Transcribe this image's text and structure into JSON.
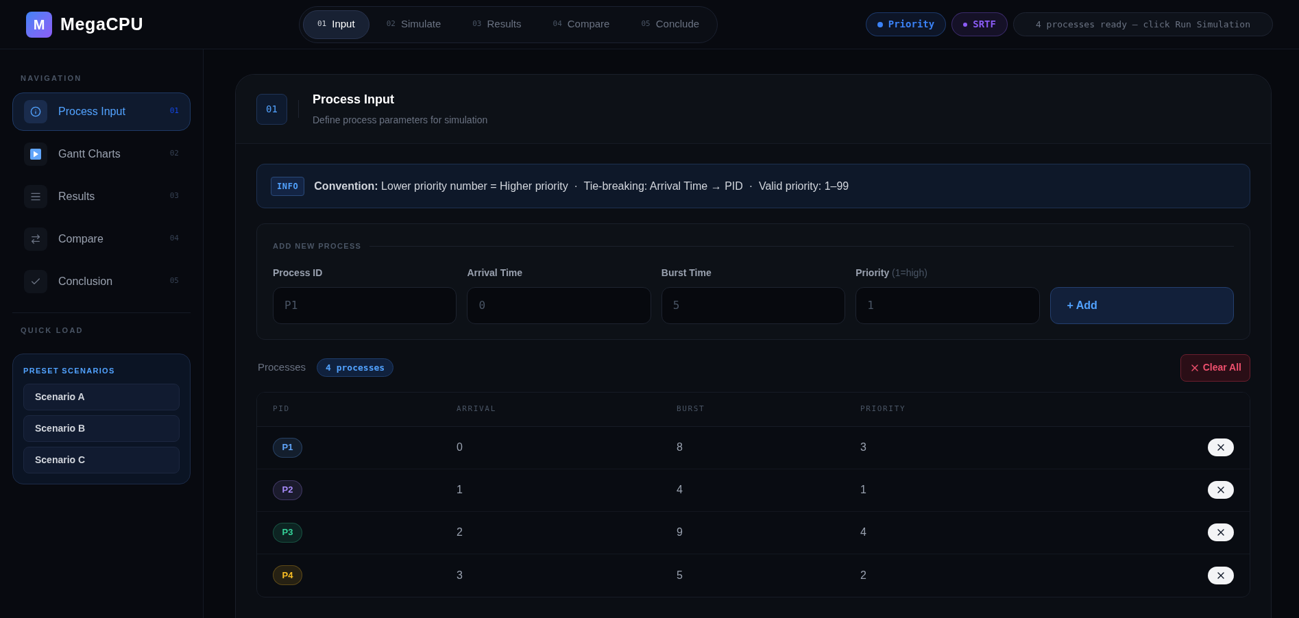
{
  "app": {
    "logo_letter": "M",
    "name": "MegaCPU"
  },
  "steps": [
    {
      "num": "01",
      "label": "Input",
      "selected": true
    },
    {
      "num": "02",
      "label": "Simulate",
      "selected": false
    },
    {
      "num": "03",
      "label": "Results",
      "selected": false
    },
    {
      "num": "04",
      "label": "Compare",
      "selected": false
    },
    {
      "num": "05",
      "label": "Conclude",
      "selected": false
    }
  ],
  "badges": [
    {
      "label": "Priority",
      "color": "#3b82f6"
    },
    {
      "label": "SRTF",
      "color": "#8b5cf6"
    }
  ],
  "status": "4 processes ready — click Run Simulation",
  "sidebar": {
    "nav_title": "NAVIGATION",
    "items": [
      {
        "kind": "info",
        "label": "Process Input",
        "num": "01",
        "selected": true
      },
      {
        "kind": "play",
        "label": "Gantt Charts",
        "num": "02",
        "selected": false
      },
      {
        "kind": "list",
        "label": "Results",
        "num": "03",
        "selected": false
      },
      {
        "kind": "swap",
        "label": "Compare",
        "num": "04",
        "selected": false
      },
      {
        "kind": "check",
        "label": "Conclusion",
        "num": "05",
        "selected": false
      }
    ],
    "quick_title": "QUICK LOAD",
    "presets": {
      "title": "PRESET SCENARIOS",
      "items": [
        "Scenario A",
        "Scenario B",
        "Scenario C"
      ]
    }
  },
  "card": {
    "num": "01",
    "title": "Process Input",
    "subtitle": "Define process parameters for simulation"
  },
  "info": {
    "tag": "INFO",
    "text": "**Convention:** Lower priority number = Higher priority  ·  Tie-breaking: Arrival Time → PID  ·  Valid priority: 1–99"
  },
  "form": {
    "title": "ADD NEW PROCESS",
    "fields": [
      {
        "label": "Process ID",
        "placeholder": "P1"
      },
      {
        "label": "Arrival Time",
        "placeholder": "0"
      },
      {
        "label": "Burst Time",
        "placeholder": "5"
      },
      {
        "label": "Priority",
        "hint": "(1=high)",
        "placeholder": "1"
      }
    ],
    "add_button": "+ Add"
  },
  "processes": {
    "label": "Processes",
    "count": "4 processes",
    "clear_button": "Clear All"
  },
  "table": {
    "columns": [
      "PID",
      "ARRIVAL",
      "BURST",
      "PRIORITY"
    ],
    "rows": [
      {
        "pid": "P1",
        "color": "#60a5fa",
        "arrival": "0",
        "burst": "8",
        "priority": "3"
      },
      {
        "pid": "P2",
        "color": "#a78bfa",
        "arrival": "1",
        "burst": "4",
        "priority": "1"
      },
      {
        "pid": "P3",
        "color": "#34d399",
        "arrival": "2",
        "burst": "9",
        "priority": "4"
      },
      {
        "pid": "P4",
        "color": "#fbbf24",
        "arrival": "3",
        "burst": "5",
        "priority": "2"
      }
    ]
  }
}
